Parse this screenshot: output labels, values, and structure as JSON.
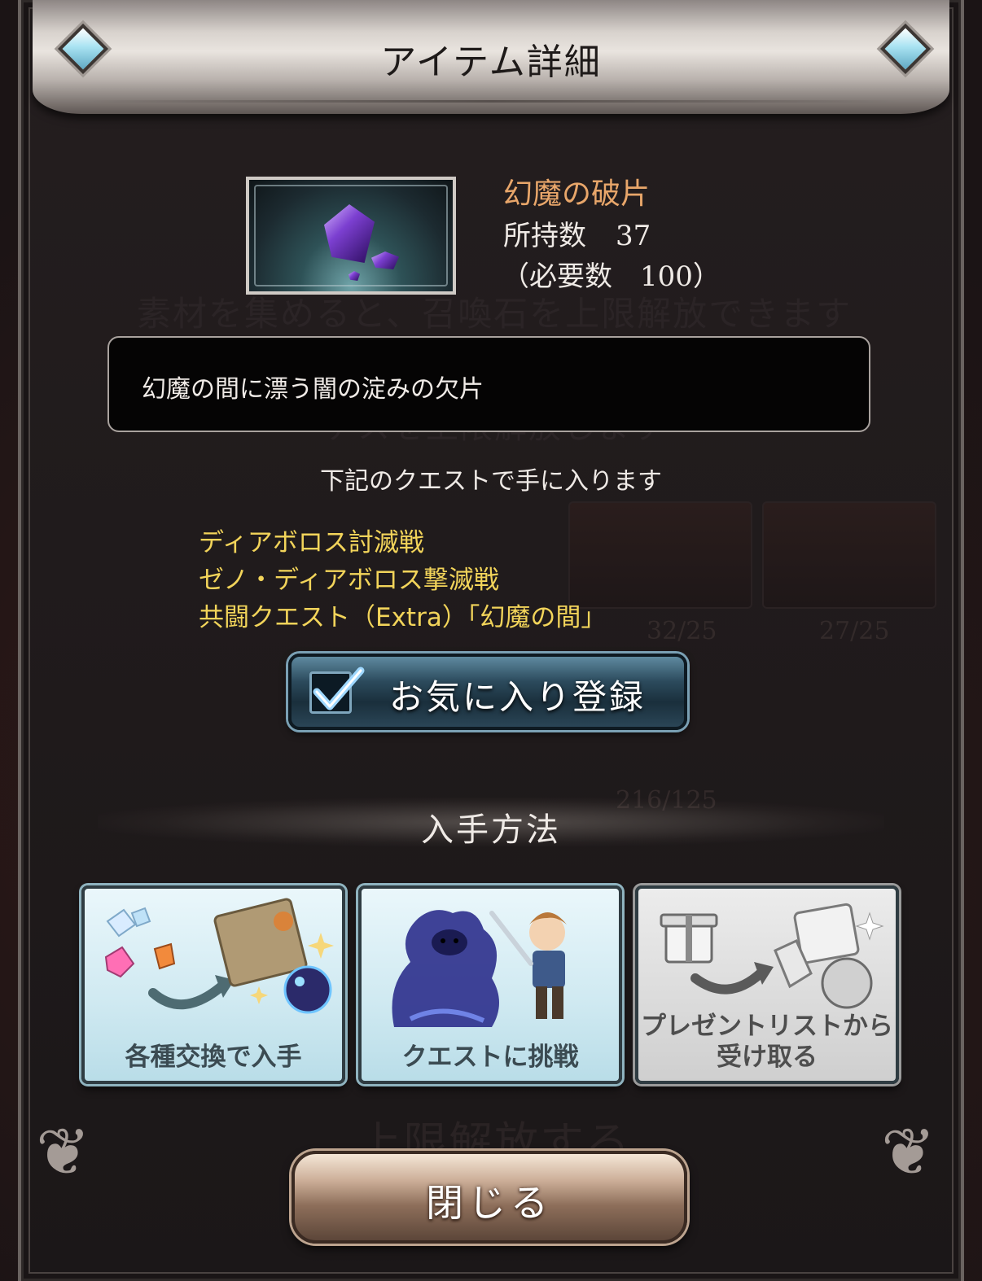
{
  "dialog": {
    "title": "アイテム詳細"
  },
  "item": {
    "name": "幻魔の破片",
    "owned_label": "所持数",
    "owned_count": "37",
    "required_open": "（必要数",
    "required_count": "100",
    "required_close": "）",
    "description": "幻魔の間に漂う闇の淀みの欠片"
  },
  "quests": {
    "intro": "下記のクエストで手に入ります",
    "items": [
      "ディアボロス討滅戦",
      "ゼノ・ディアボロス撃滅戦",
      "共闘クエスト（Extra）「幻魔の間」"
    ]
  },
  "favorite": {
    "label": "お気に入り登録",
    "checked": true,
    "icon": "checkmark-icon"
  },
  "acquisition": {
    "heading": "入手方法",
    "cards": [
      {
        "label": "各種交換で入手",
        "icon": "exchange-icon",
        "enabled": true
      },
      {
        "label": "クエストに挑戦",
        "icon": "quest-battle-icon",
        "enabled": true
      },
      {
        "label_line1": "プレゼントリストから",
        "label_line2": "受け取る",
        "icon": "present-box-icon",
        "enabled": false
      }
    ]
  },
  "close_button": {
    "label": "閉じる"
  },
  "background": {
    "line1": "素材を集めると、召喚石を上限解放できます",
    "line2": "デスを上限解放します",
    "count_a": "32/25",
    "count_b": "27/25",
    "count_c": "216/125",
    "button": "上限解放する"
  },
  "colors": {
    "item_name": "#e8a66a",
    "quest_name": "#f2d45a",
    "text": "#efeae6",
    "favorite_button": "#2c4b5d",
    "close_button": "#cdb09a"
  }
}
